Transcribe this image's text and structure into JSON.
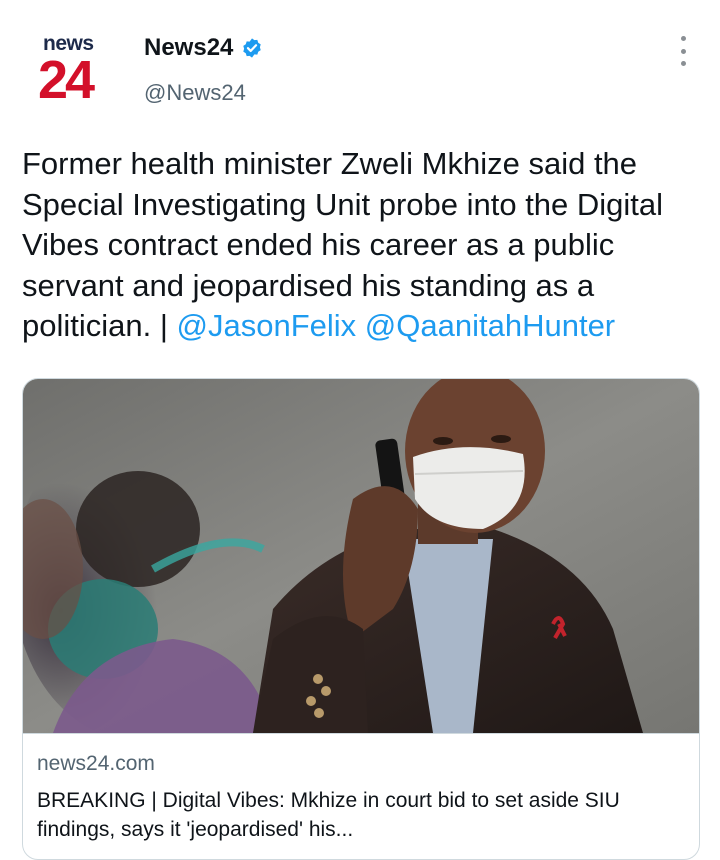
{
  "account": {
    "logo_top": "news",
    "logo_bottom": "24",
    "display_name": "News24",
    "handle": "@News24",
    "verified_icon": "verified-badge-icon",
    "more_icon": "more-vertical-icon"
  },
  "tweet": {
    "text_main": "Former health minister Zweli Mkhize said the Special Investigating Unit probe into the Digital Vibes contract ended his career as a public servant and jeopardised his standing as a politician. | ",
    "mention_1": "@JasonFelix",
    "separator": " ",
    "mention_2": "@QaanitahHunter"
  },
  "card": {
    "domain": "news24.com",
    "title": "BREAKING | Digital Vibes: Mkhize in court bid to set aside SIU findings, says it 'jeopardised' his..."
  },
  "colors": {
    "brand_red": "#d3102a",
    "link_blue": "#1d9bf0",
    "muted": "#536471"
  }
}
